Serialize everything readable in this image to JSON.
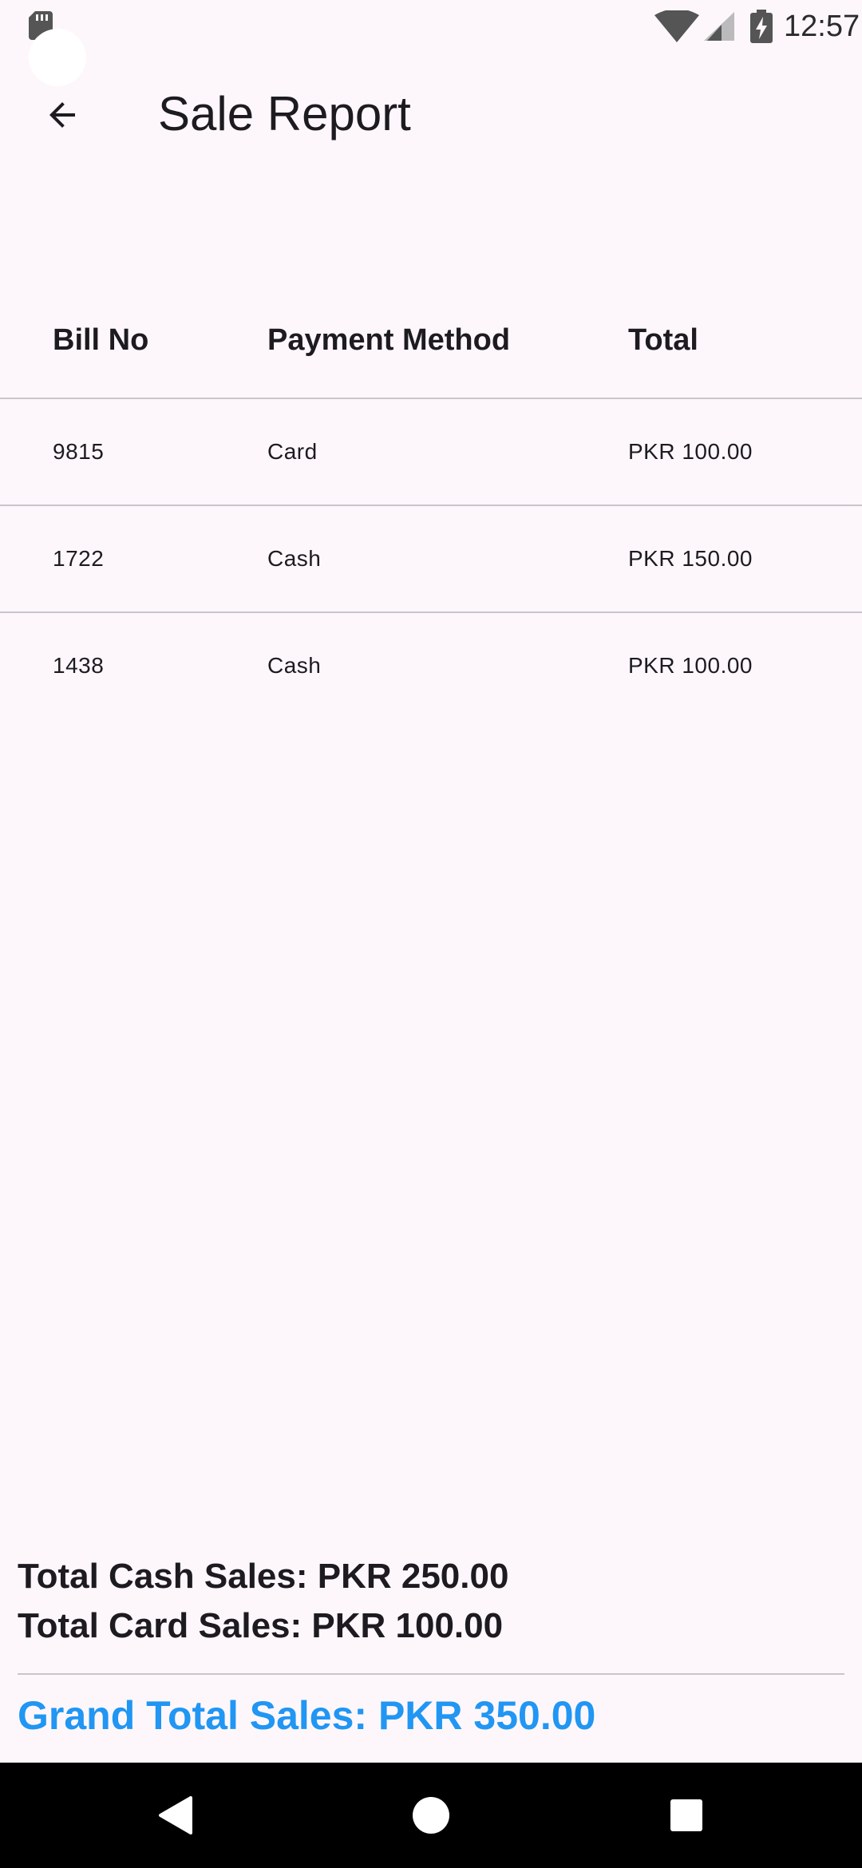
{
  "status_bar": {
    "time": "12:57",
    "icons": [
      "sd-card-icon",
      "wifi-icon",
      "signal-icon",
      "battery-charging-icon"
    ]
  },
  "app_bar": {
    "title": "Sale Report",
    "back_icon": "arrow-back-icon"
  },
  "table": {
    "headers": [
      "Bill No",
      "Payment Method",
      "Total"
    ],
    "rows": [
      {
        "bill_no": "9815",
        "method": "Card",
        "total": "PKR 100.00"
      },
      {
        "bill_no": "1722",
        "method": "Cash",
        "total": "PKR 150.00"
      },
      {
        "bill_no": "1438",
        "method": "Cash",
        "total": "PKR 100.00"
      }
    ]
  },
  "summary": {
    "cash": "Total Cash Sales: PKR 250.00",
    "card": "Total Card Sales: PKR 100.00",
    "grand": "Grand Total Sales: PKR 350.00"
  },
  "colors": {
    "background": "#fdf7fc",
    "accent": "#2196f3",
    "divider": "#c9c5ca",
    "text": "#1d1b20"
  },
  "nav_bar": {
    "icons": [
      "nav-back-icon",
      "nav-home-icon",
      "nav-recents-icon"
    ]
  }
}
